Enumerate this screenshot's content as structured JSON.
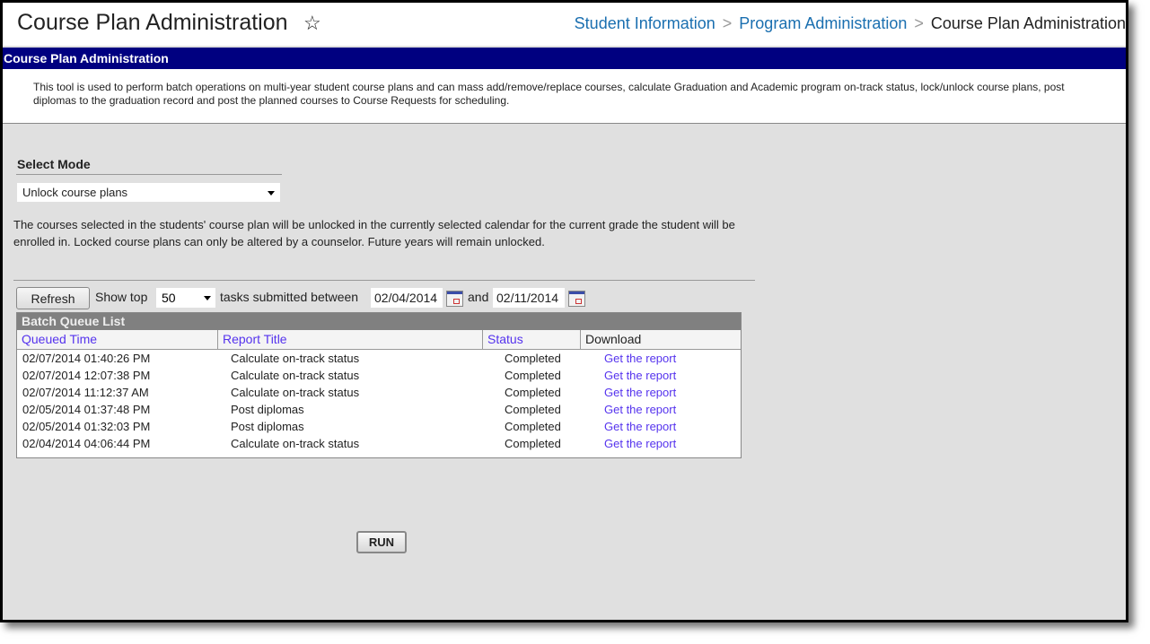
{
  "header": {
    "title": "Course Plan Administration",
    "breadcrumb": [
      "Student Information",
      "Program Administration",
      "Course Plan Administration"
    ]
  },
  "panel": {
    "title": "Course Plan Administration",
    "description": "This tool is used to perform batch operations on multi-year student course plans and can mass add/remove/replace courses, calculate Graduation and Academic program on-track status, lock/unlock course plans, post diplomas to the graduation record and post the planned courses to Course Requests for scheduling."
  },
  "mode": {
    "label": "Select Mode",
    "selected": "Unlock course plans",
    "description": "The courses selected in the students' course plan will be unlocked in the currently selected calendar for the current grade the student will be enrolled in. Locked course plans can only be altered by a counselor. Future years will remain unlocked."
  },
  "filter": {
    "refresh_label": "Refresh",
    "show_top_label": "Show top",
    "show_top_value": "50",
    "between_label": "tasks submitted between",
    "start_date": "02/04/2014",
    "and_label": "and",
    "end_date": "02/11/2014"
  },
  "batch_queue": {
    "title": "Batch Queue List",
    "columns": [
      "Queued Time",
      "Report Title",
      "Status",
      "Download"
    ],
    "rows": [
      {
        "time": "02/07/2014 01:40:26 PM",
        "title": "Calculate on-track status",
        "status": "Completed",
        "download": "Get the report"
      },
      {
        "time": "02/07/2014 12:07:38 PM",
        "title": "Calculate on-track status",
        "status": "Completed",
        "download": "Get the report"
      },
      {
        "time": "02/07/2014 11:12:37 AM",
        "title": "Calculate on-track status",
        "status": "Completed",
        "download": "Get the report"
      },
      {
        "time": "02/05/2014 01:37:48 PM",
        "title": "Post diplomas",
        "status": "Completed",
        "download": "Get the report"
      },
      {
        "time": "02/05/2014 01:32:03 PM",
        "title": "Post diplomas",
        "status": "Completed",
        "download": "Get the report"
      },
      {
        "time": "02/04/2014 04:06:44 PM",
        "title": "Calculate on-track status",
        "status": "Completed",
        "download": "Get the report"
      }
    ]
  },
  "run_label": "RUN",
  "colors": {
    "header_bar": "#000080",
    "link": "#5533ee",
    "breadcrumb_link": "#1a6fb0",
    "background": "#e0e0e0"
  }
}
